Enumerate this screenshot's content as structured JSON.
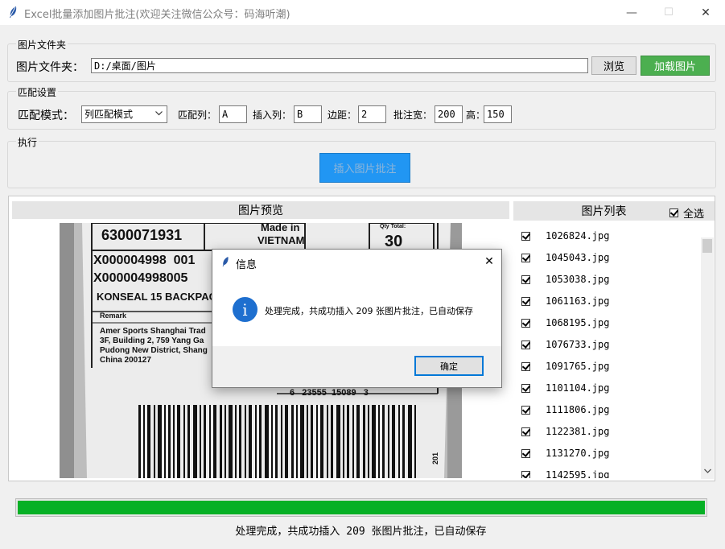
{
  "window": {
    "title": "Excel批量添加图片批注(欢迎关注微信公众号：码海听潮)",
    "minimize_glyph": "—",
    "maximize_glyph": "☐",
    "close_glyph": "✕"
  },
  "folder_group": {
    "title": "图片文件夹",
    "label": "图片文件夹：",
    "path_value": "D:/桌面/图片",
    "browse_label": "浏览",
    "load_label": "加载图片"
  },
  "match_group": {
    "title": "匹配设置",
    "mode_label": "匹配模式：",
    "mode_value": "列匹配模式",
    "match_col_label": "匹配列：",
    "match_col_value": "A",
    "insert_col_label": "插入列：",
    "insert_col_value": "B",
    "margin_label": "边距：",
    "margin_value": "2",
    "width_label": "批注宽：",
    "width_value": "200",
    "height_label": "高：",
    "height_value": "150"
  },
  "exec_group": {
    "title": "执行",
    "run_label": "插入图片批注"
  },
  "preview": {
    "header": "图片预览",
    "label_lines": {
      "sku": "6300071931",
      "made_in": "Made in",
      "country": "VIETNAM",
      "qty_label": "Qty Total:",
      "qty": "30",
      "code1": "X000004998  001",
      "code2": "X000004998005",
      "product": "KONSEAL 15 BACKPACK",
      "remark": "Remark",
      "addr1": "Amer Sports Shanghai Trad",
      "addr2": "3F, Building 2, 759 Yang Ga",
      "addr3": "Pudong New District, Shang",
      "addr4": "China 200127",
      "barcode_num": "6   23555  15089   3",
      "side_num": "201"
    }
  },
  "image_list": {
    "header": "图片列表",
    "select_all_label": "全选",
    "items": [
      "1026824.jpg",
      "1045043.jpg",
      "1053038.jpg",
      "1061163.jpg",
      "1068195.jpg",
      "1076733.jpg",
      "1091765.jpg",
      "1101104.jpg",
      "1111806.jpg",
      "1122381.jpg",
      "1131270.jpg",
      "1142595.jpg"
    ]
  },
  "progress": {
    "percent": 100,
    "status": "处理完成，共成功插入 209 张图片批注，已自动保存"
  },
  "dialog": {
    "title": "信息",
    "icon_glyph": "i",
    "message": "处理完成，共成功插入 209 张图片批注，已自动保存",
    "ok_label": "确定",
    "close_glyph": "✕"
  },
  "colors": {
    "load_button": "#4caf50",
    "run_button": "#2196f3",
    "progress_fill": "#06b025",
    "info_icon": "#1e6fcf"
  }
}
